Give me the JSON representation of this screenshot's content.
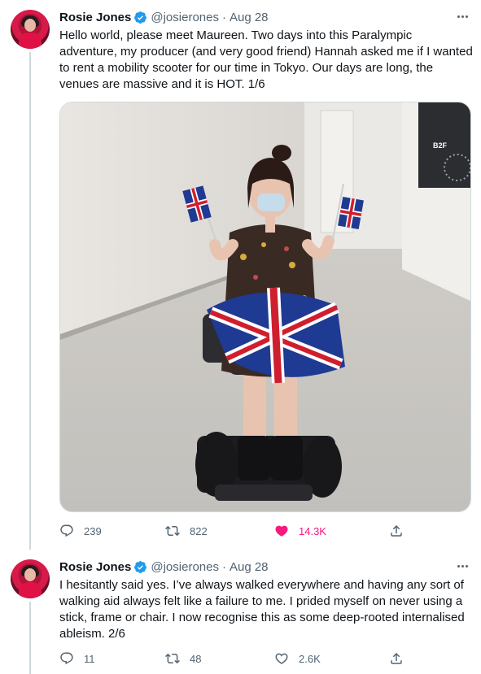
{
  "tweets": [
    {
      "author": {
        "name": "Rosie Jones",
        "handle": "@josierones",
        "verified": true
      },
      "separator": "·",
      "date": "Aug 28",
      "text": "Hello world, please meet Maureen. Two days into this Paralympic\nadventure, my producer (and very good friend) Hannah asked me if I wanted\nto rent a mobility scooter for our time in Tokyo. Our days are long, the\nvenues are massive and it is HOT. 1/6",
      "media_sign": "B2F",
      "stats": {
        "replies": "239",
        "retweets": "822",
        "likes": "14.3K",
        "liked": true
      }
    },
    {
      "author": {
        "name": "Rosie Jones",
        "handle": "@josierones",
        "verified": true
      },
      "separator": "·",
      "date": "Aug 28",
      "text": "I hesitantly said yes. I’ve always walked everywhere and having any sort of\nwalking aid always felt like a failure to me. I prided myself on never using a\nstick, frame or chair. I now recognise this as some deep-rooted internalised\nableism. 2/6",
      "stats": {
        "replies": "11",
        "retweets": "48",
        "likes": "2.6K",
        "liked": false
      }
    }
  ],
  "colors": {
    "text": "#0f1419",
    "secondary": "#536471",
    "verified": "#1d9bf0",
    "like": "#f91880",
    "border": "#cfd9de"
  },
  "icons": {
    "verified": "verified-badge-icon",
    "more": "more-options-icon",
    "reply": "reply-icon",
    "retweet": "retweet-icon",
    "like": "heart-icon",
    "share": "share-icon"
  }
}
